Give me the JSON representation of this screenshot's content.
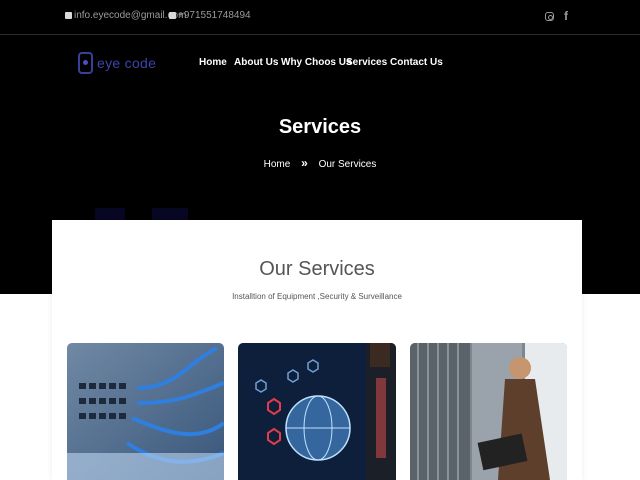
{
  "topbar": {
    "email": "info.eyecode@gmail.com",
    "phone": "+971551748494",
    "icons": [
      "mail-icon",
      "phone-icon",
      "instagram-icon",
      "facebook-icon"
    ]
  },
  "brand": {
    "name": "eye code"
  },
  "nav": {
    "items": [
      {
        "label": "Home"
      },
      {
        "label": "About Us"
      },
      {
        "label": "Why Choos Us"
      },
      {
        "label": "Services"
      },
      {
        "label": "Contact Us"
      }
    ]
  },
  "hero": {
    "title": "Services",
    "breadcrumb": {
      "home": "Home",
      "separator": "»",
      "current": "Our Services"
    }
  },
  "section": {
    "title": "Our Services",
    "subtitle": "Installtion of Equipment ,Security & Surveillance"
  },
  "cards": [
    {
      "image": "network-cables-image"
    },
    {
      "image": "digital-globe-image"
    },
    {
      "image": "server-room-technician-image"
    }
  ],
  "colors": {
    "background_dark": "#000000",
    "brand_blue": "#3d43a8",
    "card_bg": "#ffffff",
    "heading_gray": "#555555"
  }
}
